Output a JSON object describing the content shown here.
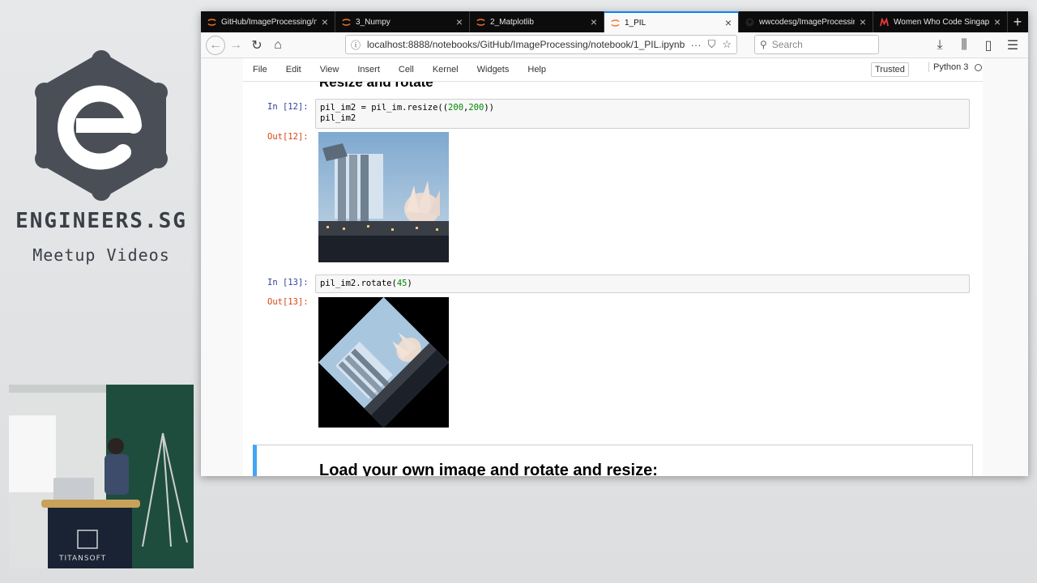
{
  "brand": {
    "title": "ENGINEERS.SG",
    "subtitle": "Meetup Videos",
    "logo_icon": "hexagon-e-logo-icon",
    "video_watermark": "TITANSOFT"
  },
  "browser": {
    "tabs": [
      {
        "label": "GitHub/ImageProcessing/nc",
        "icon": "jupyter-icon"
      },
      {
        "label": "3_Numpy",
        "icon": "jupyter-icon"
      },
      {
        "label": "2_Matplotlib",
        "icon": "jupyter-icon"
      },
      {
        "label": "1_PIL",
        "icon": "jupyter-icon",
        "active": true
      },
      {
        "label": "wwcodesg/ImageProcessing",
        "icon": "github-icon"
      },
      {
        "label": "Women Who Code Singapore",
        "icon": "meetup-icon"
      }
    ],
    "url": "localhost:8888/notebooks/GitHub/ImageProcessing/notebook/1_PIL.ipynb",
    "search_placeholder": "Search"
  },
  "jupyter": {
    "menu": [
      "File",
      "Edit",
      "View",
      "Insert",
      "Cell",
      "Kernel",
      "Widgets",
      "Help"
    ],
    "trusted_label": "Trusted",
    "kernel_label": "Python 3",
    "section_heading": "Resize and rotate",
    "cells": [
      {
        "in_prompt": "In [12]:",
        "out_prompt": "Out[12]:",
        "code_line1_a": "pil_im2 = pil_im.resize((",
        "code_line1_n1": "200",
        "code_line1_b": ",",
        "code_line1_n2": "200",
        "code_line1_c": "))",
        "code_line2": "pil_im2"
      },
      {
        "in_prompt": "In [13]:",
        "out_prompt": "Out[13]:",
        "code_line1_a": "pil_im2.rotate(",
        "code_line1_n1": "45",
        "code_line1_c": ")"
      }
    ],
    "markdown_heading": "Load your own image and rotate and resize:"
  },
  "colors": {
    "accent_tab": "#0a84ff",
    "in_prompt": "#303f9f",
    "out_prompt": "#d84315",
    "md_border": "#42a5f5"
  }
}
